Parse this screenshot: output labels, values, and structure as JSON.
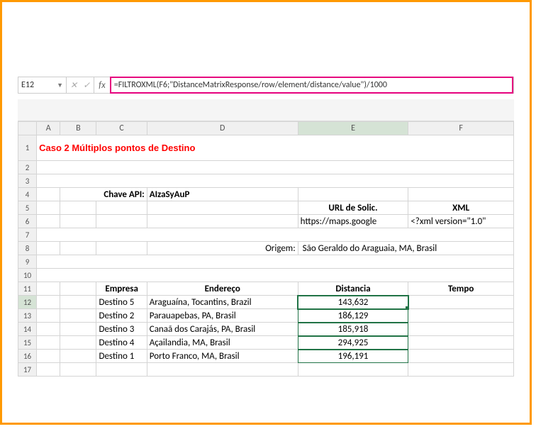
{
  "formula_bar": {
    "name_box": "E12",
    "fx_cancel": "✕",
    "fx_enter": "✓",
    "fx_label": "fx",
    "formula": "=FILTROXML(F6;\"DistanceMatrixResponse/row/element/distance/value\")/1000"
  },
  "columns": [
    "A",
    "B",
    "C",
    "D",
    "E",
    "F"
  ],
  "rows": [
    "1",
    "2",
    "3",
    "4",
    "5",
    "6",
    "7",
    "8",
    "9",
    "10",
    "11",
    "12",
    "13",
    "14",
    "15",
    "16",
    "17"
  ],
  "title": "Caso 2 Múltiplos pontos de Destino",
  "api_label": "Chave API:",
  "api_key": "AIzaSyAuP",
  "url_header": "URL de Solic.",
  "xml_header": "XML",
  "url_value": "https://maps.google",
  "xml_value": "<?xml version=\"1.0\"",
  "origem_label": "Origem:",
  "origem_value": "São Geraldo do Araguaia, MA, Brasil",
  "table_headers": {
    "empresa": "Empresa",
    "endereco": "Endereço",
    "distancia": "Distancia",
    "tempo": "Tempo"
  },
  "table_rows": [
    {
      "empresa": "Destino 5",
      "endereco": "Araguaína, Tocantins, Brazil",
      "dist": "143,632",
      "tempo": ""
    },
    {
      "empresa": "Destino 2",
      "endereco": "Parauapebas, PA, Brasil",
      "dist": "186,129",
      "tempo": ""
    },
    {
      "empresa": "Destino 3",
      "endereco": "Canaã dos Carajás, PA, Brasil",
      "dist": "185,918",
      "tempo": ""
    },
    {
      "empresa": "Destino 4",
      "endereco": "Açailandia, MA, Brasil",
      "dist": "294,925",
      "tempo": ""
    },
    {
      "empresa": "Destino 1",
      "endereco": "Porto Franco, MA, Brasil",
      "dist": "196,191",
      "tempo": ""
    }
  ]
}
